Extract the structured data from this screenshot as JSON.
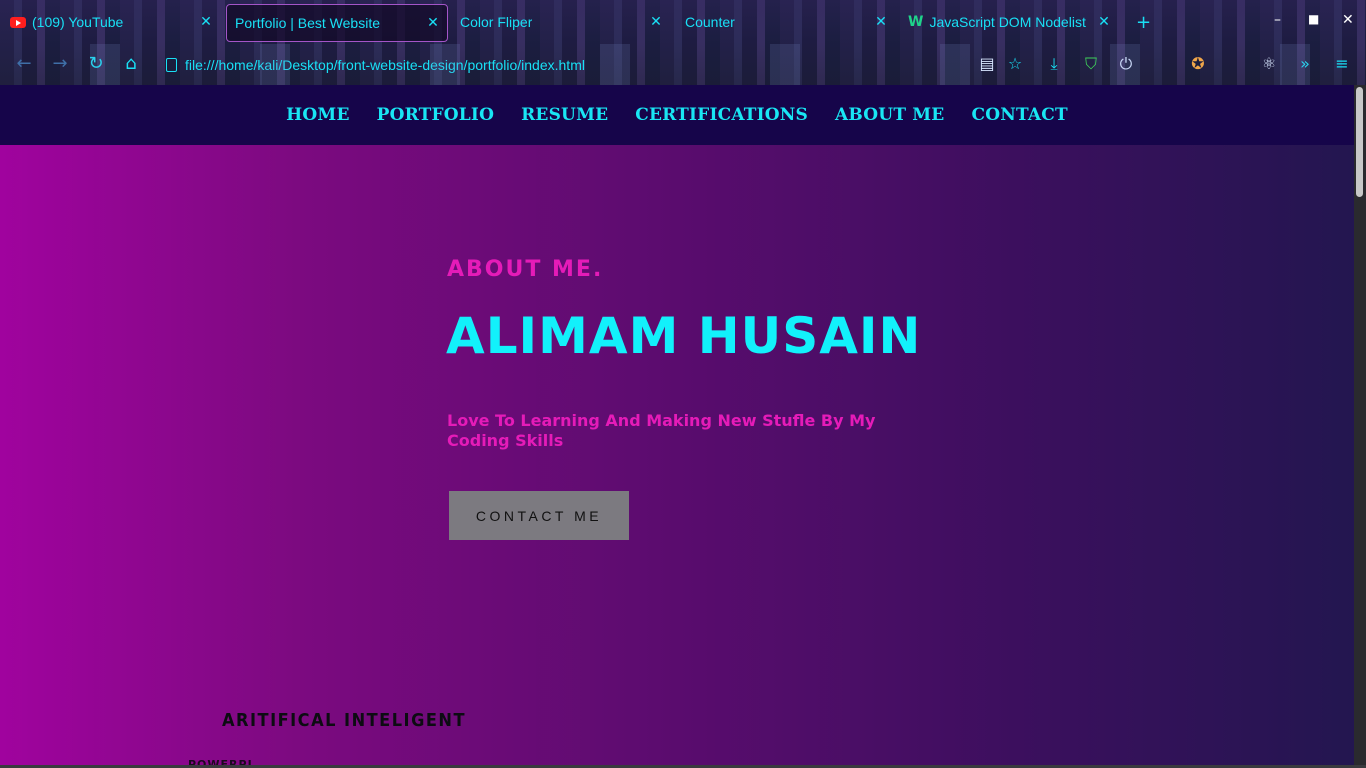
{
  "browser": {
    "tabs": [
      {
        "title": "(109) YouTube",
        "icon": "youtube-icon",
        "active": false
      },
      {
        "title": "Portfolio | Best Website",
        "active": true
      },
      {
        "title": "Color Fliper",
        "active": false
      },
      {
        "title": "Counter",
        "active": false
      },
      {
        "title": "JavaScript DOM Nodelist",
        "icon": "webflow-icon",
        "active": false
      }
    ],
    "url": "file:///home/kali/Desktop/front-website-design/portfolio/index.html",
    "accent_color": "#19e0f5"
  },
  "nav": {
    "items": [
      "HOME",
      "PORTFOLIO",
      "RESUME",
      "CERTIFICATIONS",
      "ABOUT ME",
      "CONTACT"
    ]
  },
  "hero": {
    "kicker": "ABOUT ME.",
    "name": "ALIMAM HUSAIN",
    "tagline": "Love To Learning And Making New Stufle By My Coding Skills",
    "cta_label": "CONTACT ME"
  },
  "skills": {
    "heading": "ARITIFICAL INTELIGENT",
    "sub": "POWERPI"
  },
  "colors": {
    "name": "#12f1fb",
    "kicker": "#e51bb8",
    "nav_bg": "#16054a",
    "gradient_left": "#a0039e",
    "gradient_right": "#231650"
  }
}
